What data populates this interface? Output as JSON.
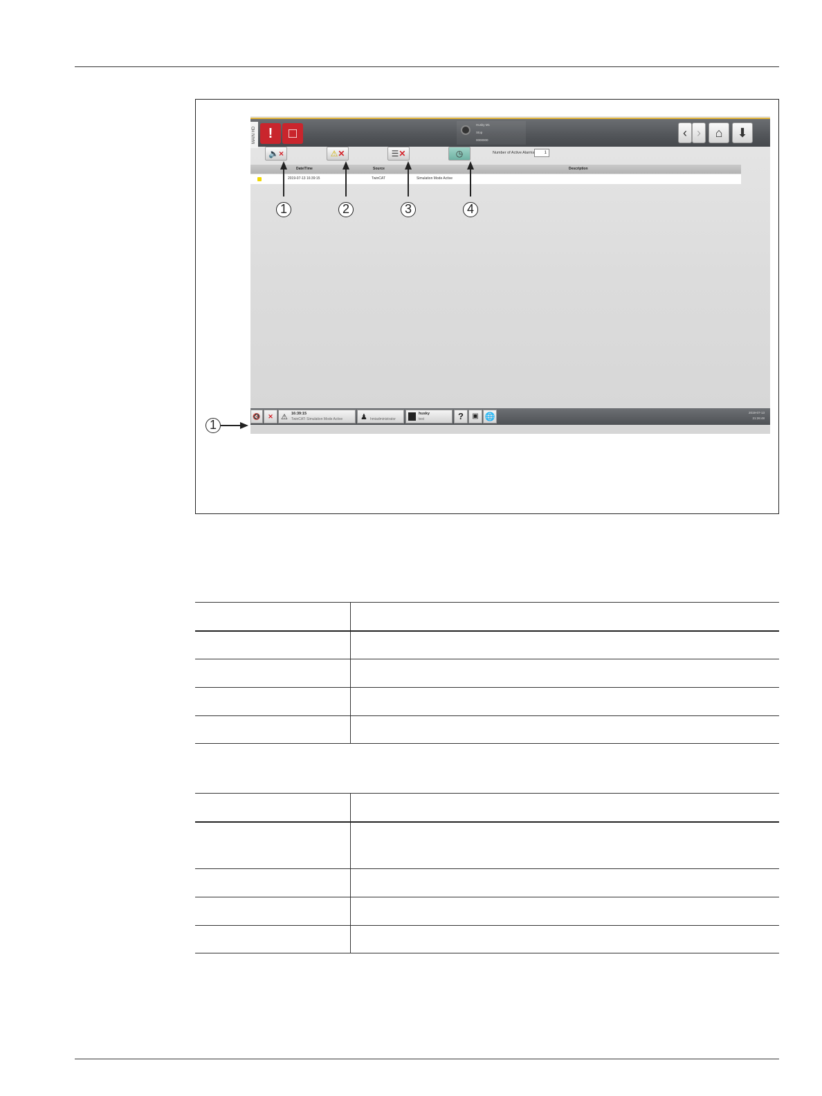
{
  "screen": {
    "side_tab": "MAIN HD",
    "machine_status": {
      "line1": "Husky M1",
      "line2": "Stop",
      "line3": "0000000"
    },
    "toolbar": {
      "active_alarms_label": "Number of Active Alarms",
      "active_alarms_value": "1"
    },
    "table": {
      "columns": [
        "Date/Time",
        "Source",
        "Description"
      ],
      "rows": [
        {
          "date_time": "2019-07-13 16:39:15",
          "source": "TwinCAT",
          "description": "Simulation Mode Active"
        }
      ]
    },
    "bottom_bar": {
      "alarm_time": "16:39:15",
      "alarm_text": "TwinCAT: Simulation Mode Active",
      "user": "hmiadministrator",
      "husky_label": "husky",
      "husky_sub": "test",
      "date": "2019-07-13",
      "time": "21:26:48"
    }
  },
  "callouts": [
    "1",
    "2",
    "3",
    "4",
    "1"
  ]
}
